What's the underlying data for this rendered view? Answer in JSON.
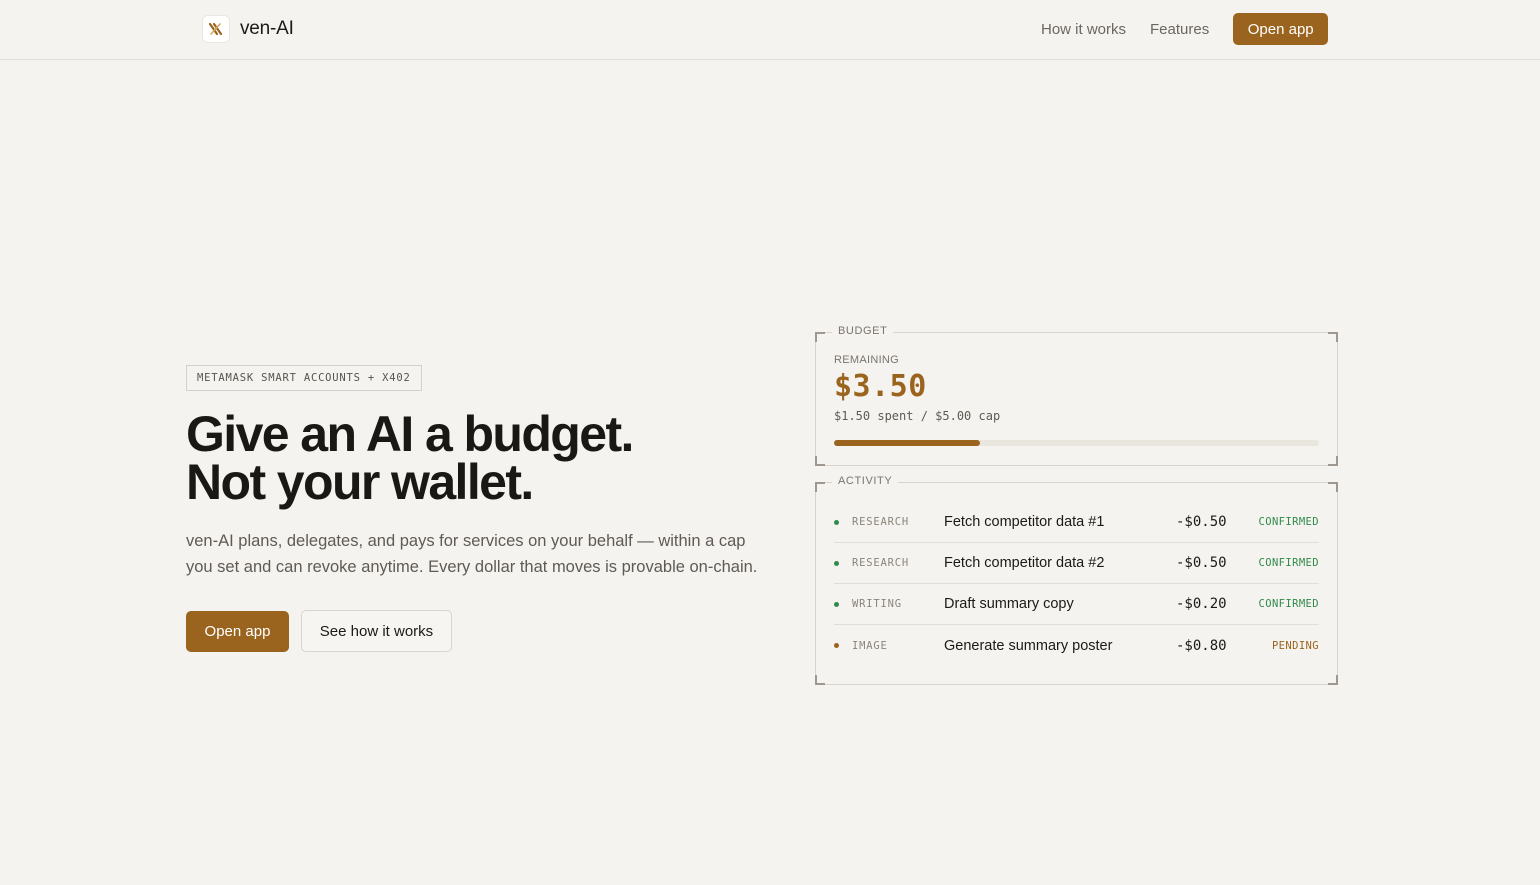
{
  "header": {
    "brand_name": "ven-AI",
    "nav": [
      {
        "label": "How it works"
      },
      {
        "label": "Features"
      }
    ],
    "cta_label": "Open app"
  },
  "hero": {
    "tagline": "METAMASK SMART ACCOUNTS + X402",
    "title_line1": "Give an AI a budget.",
    "title_line2": "Not your wallet.",
    "subtitle_line1": "ven-AI plans, delegates, and pays for services on your behalf — within a cap",
    "subtitle_line2": "you set and can revoke anytime. Every dollar that moves is provable on-chain.",
    "primary_cta": "Open app",
    "secondary_cta": "See how it works"
  },
  "budget": {
    "label": "BUDGET",
    "remaining_label": "REMAINING",
    "remaining_value": "$3.50",
    "spent_summary": "$1.50 spent / $5.00 cap",
    "spent_fraction": 0.3
  },
  "activity": {
    "label": "ACTIVITY",
    "items": [
      {
        "category": "RESEARCH",
        "description": "Fetch competitor data #1",
        "amount": "-$0.50",
        "status": "CONFIRMED",
        "status_color": "#2e8b4a"
      },
      {
        "category": "RESEARCH",
        "description": "Fetch competitor data #2",
        "amount": "-$0.50",
        "status": "CONFIRMED",
        "status_color": "#2e8b4a"
      },
      {
        "category": "WRITING",
        "description": "Draft summary copy",
        "amount": "-$0.20",
        "status": "CONFIRMED",
        "status_color": "#2e8b4a"
      },
      {
        "category": "IMAGE",
        "description": "Generate summary poster",
        "amount": "-$0.80",
        "status": "PENDING",
        "status_color": "#9a641f"
      }
    ]
  },
  "colors": {
    "accent": "#9a641f",
    "background": "#f5f3ef",
    "confirmed": "#2e8b4a",
    "pending": "#9a641f"
  }
}
